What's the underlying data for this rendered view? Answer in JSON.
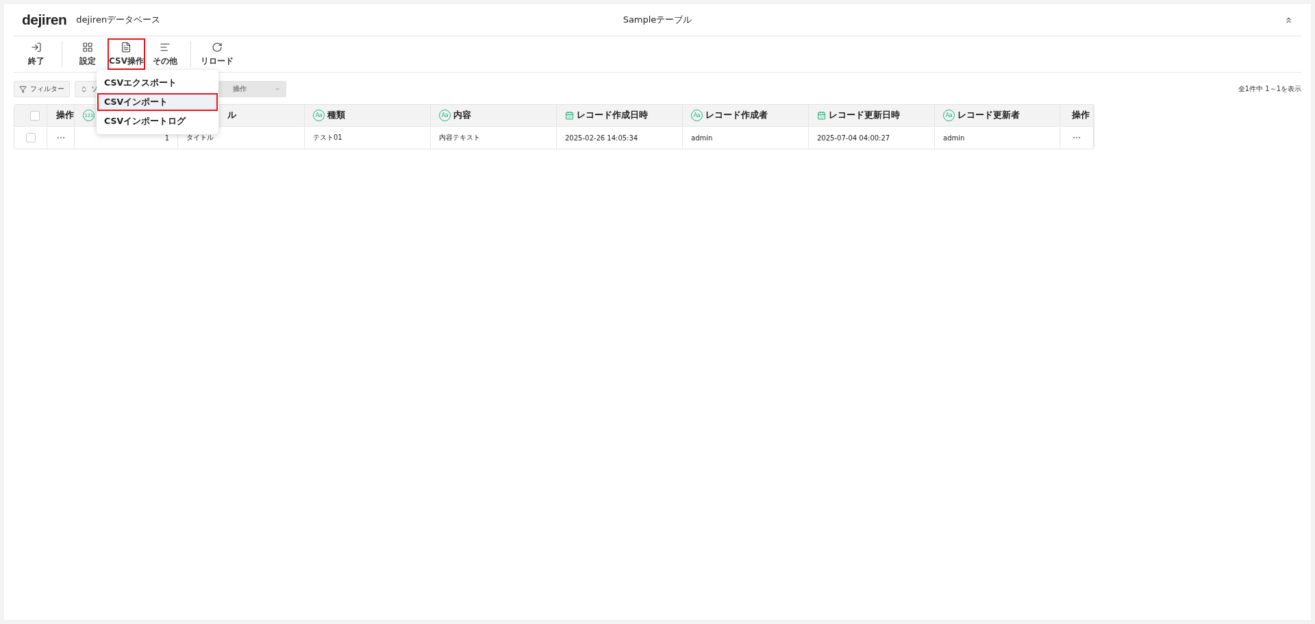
{
  "header": {
    "logo": "dejiren",
    "app_name": "dejirenデータベース",
    "title": "Sampleテーブル"
  },
  "toolbar": [
    [
      {
        "kind": "exit",
        "label": "終了",
        "selected": false
      }
    ],
    [
      {
        "kind": "grid",
        "label": "設定",
        "selected": false
      },
      {
        "kind": "file",
        "label": "CSV操作",
        "selected": true
      },
      {
        "kind": "lines",
        "label": "その他",
        "selected": false
      }
    ],
    [
      {
        "kind": "reload",
        "label": "リロード",
        "selected": false
      }
    ]
  ],
  "csv_menu": [
    {
      "label": "CSVエクスポート",
      "selected": false
    },
    {
      "label": "CSVインポート",
      "selected": true
    },
    {
      "label": "CSVインポートログ",
      "selected": false
    }
  ],
  "filter_bar": {
    "buttons": [
      {
        "kind": "filter",
        "label": "フィルター"
      },
      {
        "kind": "sort",
        "label": "ソ"
      },
      {
        "kind": "bulk",
        "label": "操作"
      }
    ],
    "count": "全1件中 1～1を表示"
  },
  "table": {
    "columns": [
      {
        "kind": "checkbox",
        "checked": false
      },
      {
        "kind": "plain",
        "label": "操作"
      },
      {
        "kind": "number",
        "badge": "123"
      },
      {
        "kind": "plain",
        "label": "ル"
      },
      {
        "kind": "text",
        "badge": "Aa",
        "label": "種類"
      },
      {
        "kind": "text",
        "badge": "Aa",
        "label": "内容"
      },
      {
        "kind": "date",
        "label": "レコード作成日時"
      },
      {
        "kind": "text",
        "badge": "Aa",
        "label": "レコード作成者"
      },
      {
        "kind": "date",
        "label": "レコード更新日時"
      },
      {
        "kind": "text",
        "badge": "Aa",
        "label": "レコード更新者"
      },
      {
        "kind": "plain",
        "label": "操作"
      }
    ],
    "rows": [
      {
        "cells": [
          {
            "kind": "checkbox",
            "checked": false
          },
          {
            "kind": "more"
          },
          {
            "kind": "text",
            "text": "1"
          },
          {
            "kind": "text",
            "text": "タイトル"
          },
          {
            "kind": "text",
            "text": "テスト01"
          },
          {
            "kind": "text",
            "text": "内容テキスト"
          },
          {
            "kind": "text",
            "text": "2025-02-26 14:05:34"
          },
          {
            "kind": "text",
            "text": "admin"
          },
          {
            "kind": "text",
            "text": "2025-07-04 04:00:27"
          },
          {
            "kind": "text",
            "text": "admin"
          },
          {
            "kind": "more"
          }
        ]
      }
    ]
  }
}
